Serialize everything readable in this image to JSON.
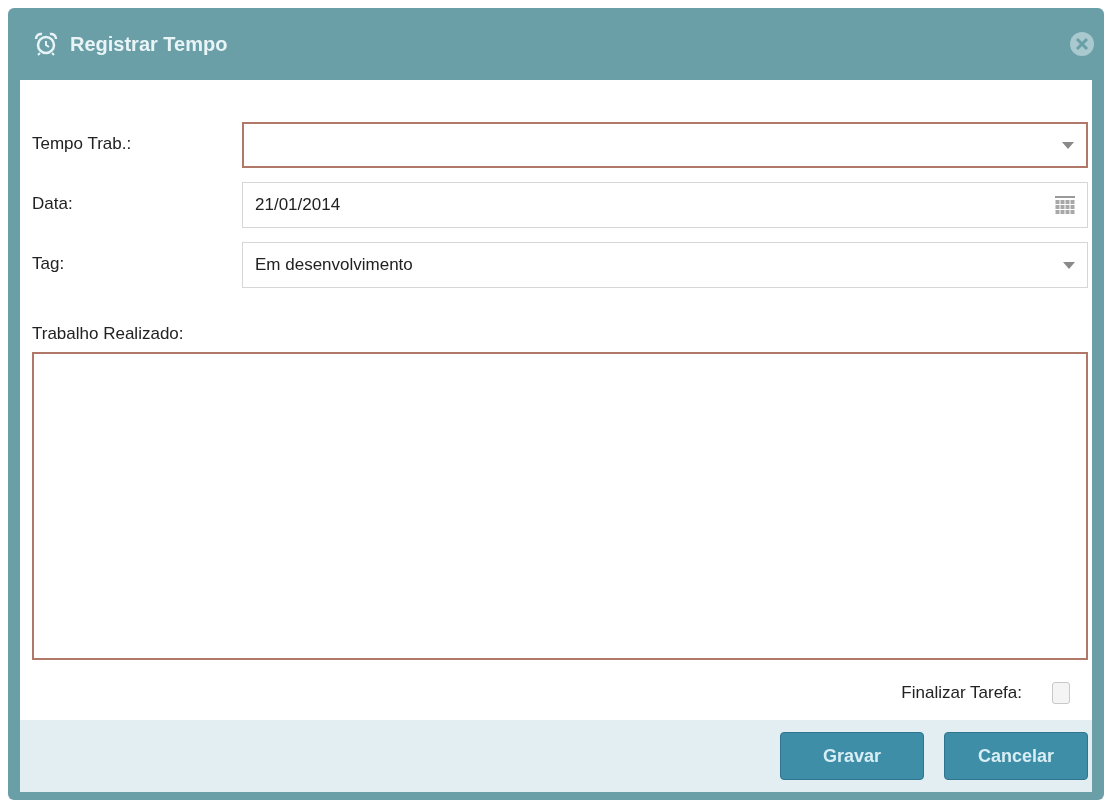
{
  "window": {
    "title": "Registrar Tempo"
  },
  "fields": [
    {
      "label": "Tempo Trab.:",
      "kind": "select",
      "invalid": true
    },
    {
      "label": "Data:",
      "kind": "date",
      "value": "21/01/2014",
      "invalid": false
    },
    {
      "label": "Tag:",
      "kind": "select",
      "value": "Em desenvolvimento",
      "invalid": false
    }
  ],
  "notes": {
    "label": "Trabalho Realizado:",
    "invalid": true
  },
  "finish": {
    "label": "Finalizar Tarefa:",
    "checked": false
  },
  "buttons": [
    "Gravar",
    "Cancelar"
  ]
}
